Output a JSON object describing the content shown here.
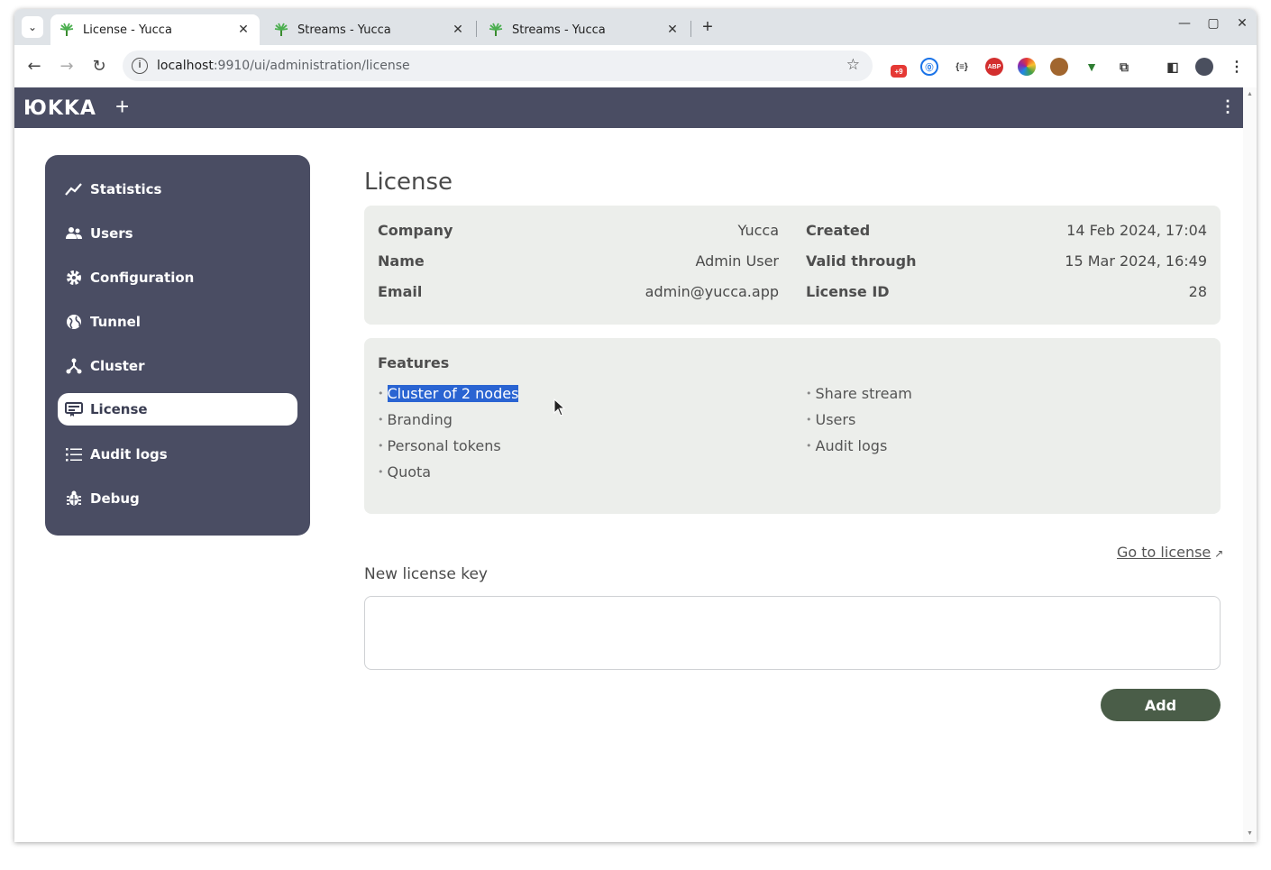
{
  "browser": {
    "tabs": [
      {
        "title": "License - Yucca",
        "active": true
      },
      {
        "title": "Streams - Yucca",
        "active": false
      },
      {
        "title": "Streams - Yucca",
        "active": false
      }
    ],
    "url_host": "localhost",
    "url_rest": ":9910/ui/administration/license",
    "extension_badge": "+9"
  },
  "app": {
    "logo": "ЮKKA",
    "sidebar": [
      {
        "label": "Statistics",
        "icon": "chart-line-icon"
      },
      {
        "label": "Users",
        "icon": "users-icon"
      },
      {
        "label": "Configuration",
        "icon": "gear-icon"
      },
      {
        "label": "Tunnel",
        "icon": "globe-icon"
      },
      {
        "label": "Cluster",
        "icon": "cluster-icon"
      },
      {
        "label": "License",
        "icon": "license-icon",
        "active": true
      },
      {
        "label": "Audit logs",
        "icon": "list-icon"
      },
      {
        "label": "Debug",
        "icon": "bug-icon"
      }
    ]
  },
  "license": {
    "title": "License",
    "left": [
      {
        "label": "Company",
        "value": "Yucca"
      },
      {
        "label": "Name",
        "value": "Admin User"
      },
      {
        "label": "Email",
        "value": "admin@yucca.app"
      }
    ],
    "right": [
      {
        "label": "Created",
        "value": "14 Feb 2024, 17:04"
      },
      {
        "label": "Valid through",
        "value": "15 Mar 2024, 16:49"
      },
      {
        "label": "License ID",
        "value": "28"
      }
    ],
    "features_title": "Features",
    "features_left": [
      "Cluster of 2 nodes",
      "Branding",
      "Personal tokens",
      "Quota"
    ],
    "features_right": [
      "Share stream",
      "Users",
      "Audit logs"
    ],
    "goto_link": "Go to license",
    "new_key_label": "New license key",
    "new_key_value": "",
    "add_button": "Add"
  },
  "colors": {
    "sidebar_bg": "#4a4d63",
    "card_bg": "#eceeeb",
    "add_button_bg": "#4a5d48",
    "selection": "#2a64d2"
  }
}
